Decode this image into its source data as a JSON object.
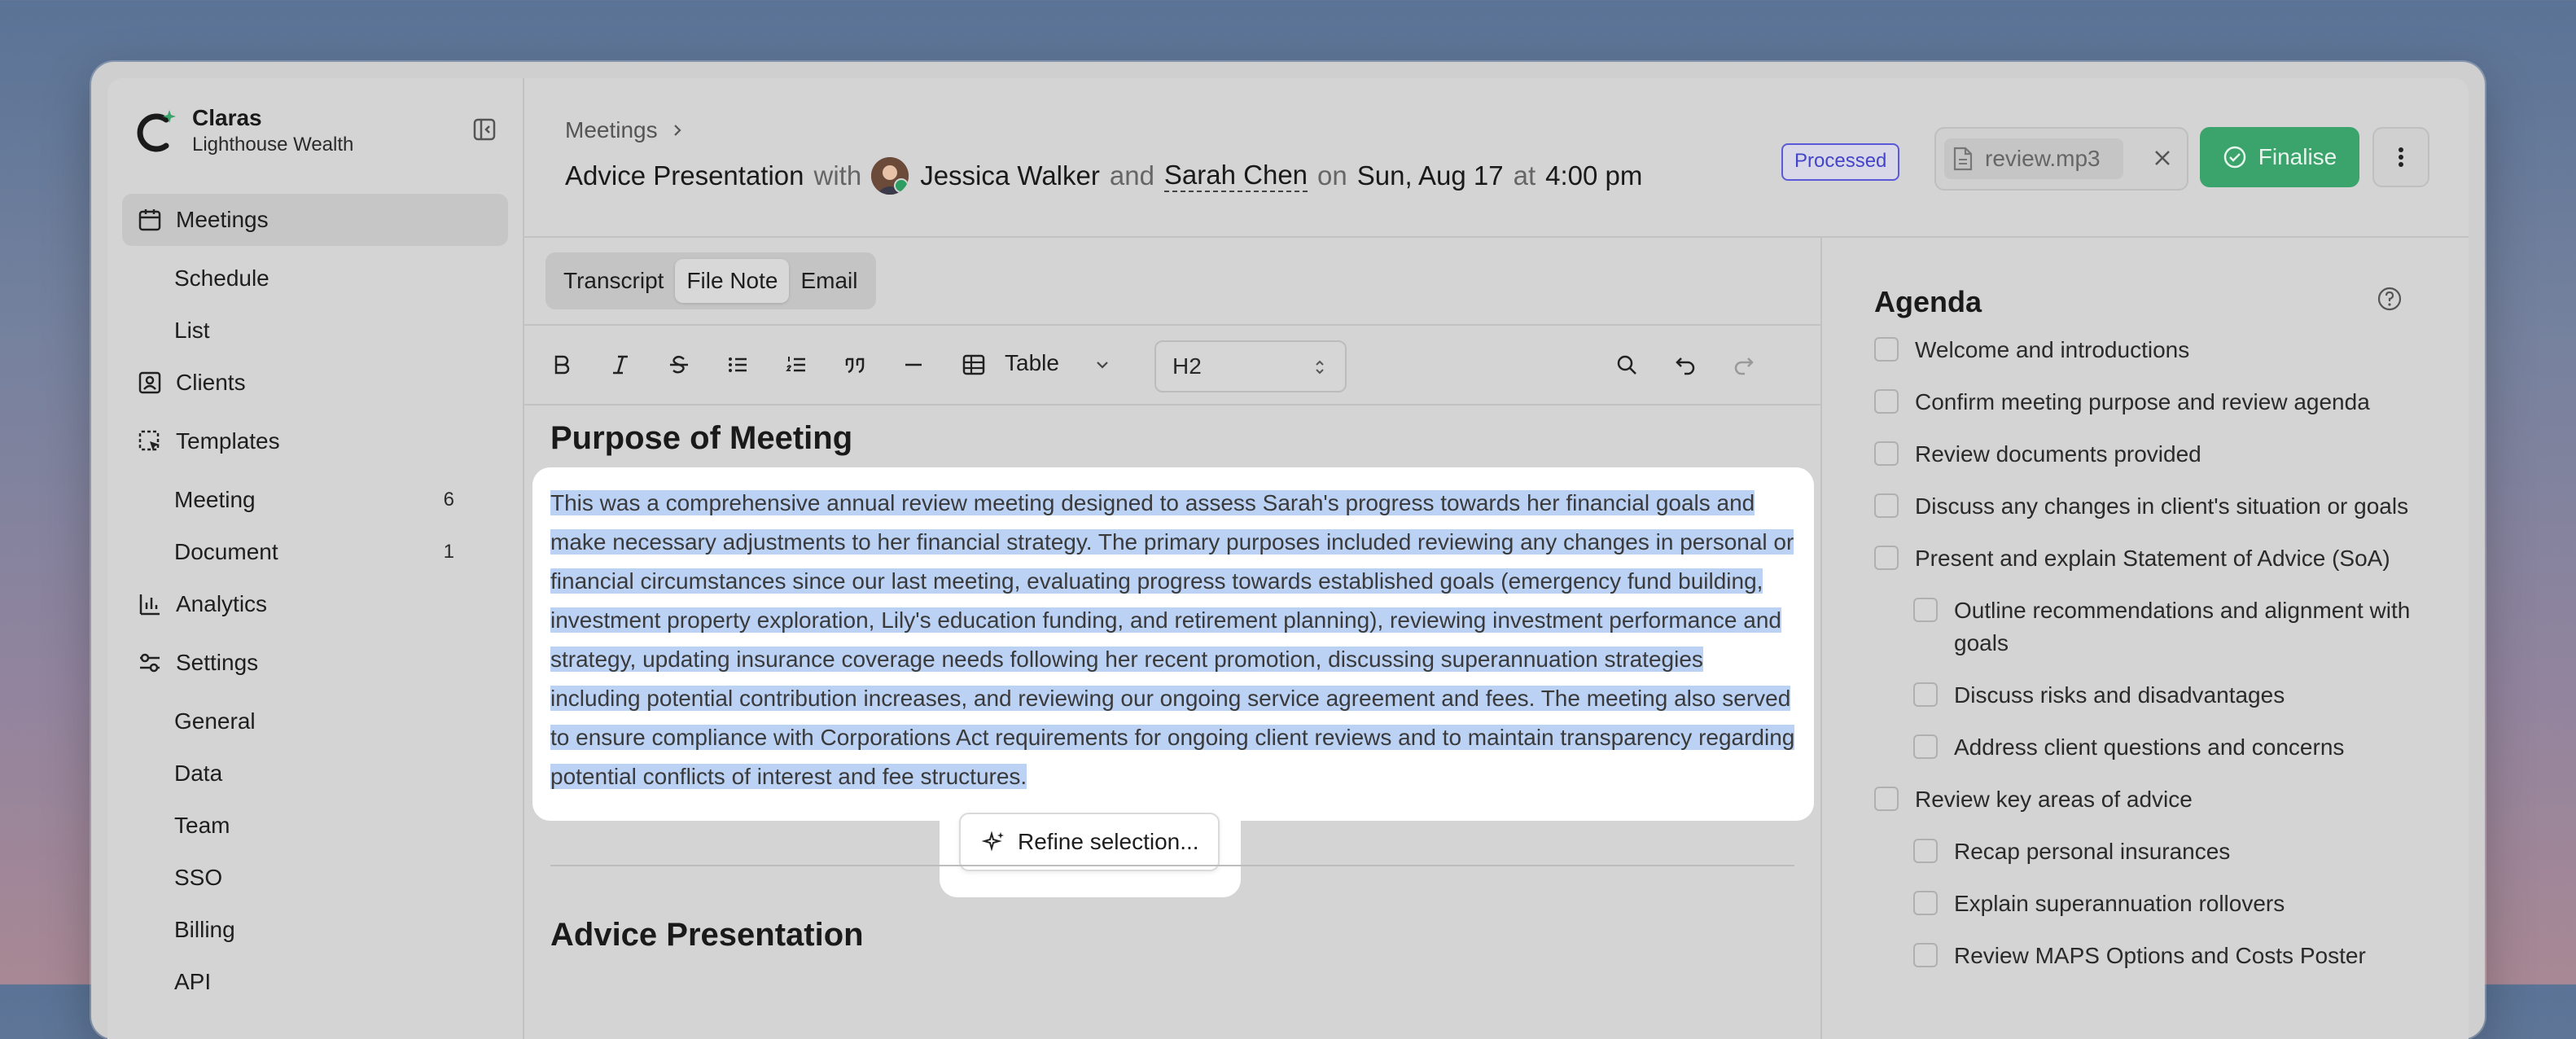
{
  "brand": {
    "name": "Claras",
    "org": "Lighthouse Wealth"
  },
  "sidebar": {
    "items": [
      {
        "label": "Meetings",
        "icon": "calendar-icon",
        "active": true
      },
      {
        "label": "Schedule"
      },
      {
        "label": "List"
      },
      {
        "label": "Clients",
        "icon": "user-card-icon"
      },
      {
        "label": "Templates",
        "icon": "template-icon"
      },
      {
        "label": "Meeting",
        "count": "6"
      },
      {
        "label": "Document",
        "count": "1"
      },
      {
        "label": "Analytics",
        "icon": "bar-chart-icon"
      },
      {
        "label": "Settings",
        "icon": "sliders-icon"
      },
      {
        "label": "General"
      },
      {
        "label": "Data"
      },
      {
        "label": "Team"
      },
      {
        "label": "SSO"
      },
      {
        "label": "Billing"
      },
      {
        "label": "API"
      }
    ]
  },
  "header": {
    "breadcrumb": "Meetings",
    "meeting_type": "Advice Presentation",
    "with_word": "with",
    "client1": "Jessica Walker",
    "and_word": "and",
    "client2": "Sarah Chen",
    "on_word": "on",
    "date": "Sun, Aug 17",
    "at_word": "at",
    "time": "4:00 pm",
    "status_badge": "Processed",
    "file_name": "review.mp3",
    "finalise_label": "Finalise"
  },
  "editor": {
    "tabs": [
      "Transcript",
      "File Note",
      "Email"
    ],
    "active_tab": "File Note",
    "table_label": "Table",
    "heading_select": "H2",
    "section1_title": "Purpose of Meeting",
    "section1_body": "This was a comprehensive annual review meeting designed to assess Sarah's progress towards her financial goals and make necessary adjustments to her financial strategy. The primary purposes included reviewing any changes in personal or financial circumstances since our last meeting, evaluating progress towards established goals (emergency fund building, investment property exploration, Lily's education funding, and retirement planning), reviewing investment performance and strategy, updating insurance coverage needs following her recent promotion, discussing superannuation strategies including potential contribution increases, and reviewing our ongoing service agreement and fees. The meeting also served to ensure compliance with Corporations Act requirements for ongoing client reviews and to maintain transparency regarding potential conflicts of interest and fee structures.",
    "refine_label": "Refine selection...",
    "section2_title": "Advice Presentation"
  },
  "agenda": {
    "title": "Agenda",
    "items": [
      {
        "label": "Welcome and introductions",
        "nested": false
      },
      {
        "label": "Confirm meeting purpose and review agenda",
        "nested": false
      },
      {
        "label": "Review documents provided",
        "nested": false
      },
      {
        "label": "Discuss any changes in client's situation or goals",
        "nested": false
      },
      {
        "label": "Present and explain Statement of Advice (SoA)",
        "nested": false
      },
      {
        "label": "Outline recommendations and alignment with goals",
        "nested": true
      },
      {
        "label": "Discuss risks and disadvantages",
        "nested": true
      },
      {
        "label": "Address client questions and concerns",
        "nested": true
      },
      {
        "label": "Review key areas of advice",
        "nested": false
      },
      {
        "label": "Recap personal insurances",
        "nested": true
      },
      {
        "label": "Explain superannuation rollovers",
        "nested": true
      },
      {
        "label": "Review MAPS Options and Costs Poster",
        "nested": true
      }
    ]
  },
  "colors": {
    "accent_green": "#3aa46c",
    "badge_blue": "#4444c8",
    "selection": "#bcd2f5"
  }
}
